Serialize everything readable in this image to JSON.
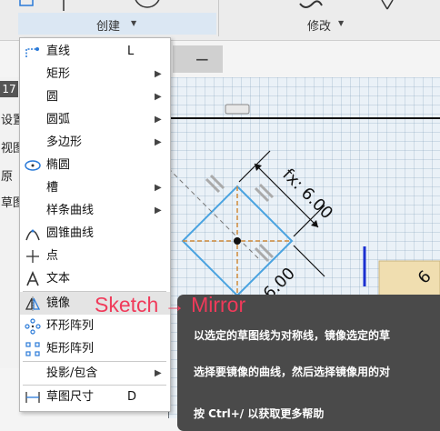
{
  "ribbon": {
    "create_label": "创建",
    "modify_label": "修改"
  },
  "left_panel": {
    "items": [
      "17",
      "设置",
      "视图",
      "原",
      "草图"
    ]
  },
  "menu": {
    "items": [
      {
        "label": "直线",
        "shortcut": "L",
        "icon": "line-icon",
        "submenu": false
      },
      {
        "label": "矩形",
        "shortcut": "",
        "icon": "",
        "submenu": true
      },
      {
        "label": "圆",
        "shortcut": "",
        "icon": "",
        "submenu": true
      },
      {
        "label": "圆弧",
        "shortcut": "",
        "icon": "",
        "submenu": true
      },
      {
        "label": "多边形",
        "shortcut": "",
        "icon": "",
        "submenu": true
      },
      {
        "label": "椭圆",
        "shortcut": "",
        "icon": "ellipse-icon",
        "submenu": false
      },
      {
        "label": "槽",
        "shortcut": "",
        "icon": "",
        "submenu": true
      },
      {
        "label": "样条曲线",
        "shortcut": "",
        "icon": "",
        "submenu": true
      },
      {
        "label": "圆锥曲线",
        "shortcut": "",
        "icon": "conic-curve-icon",
        "submenu": false
      },
      {
        "label": "点",
        "shortcut": "",
        "icon": "point-icon",
        "submenu": false
      },
      {
        "label": "文本",
        "shortcut": "",
        "icon": "text-icon",
        "submenu": false
      },
      {
        "label": "镜像",
        "shortcut": "",
        "icon": "mirror-icon",
        "submenu": false,
        "highlighted": true
      },
      {
        "label": "环形阵列",
        "shortcut": "",
        "icon": "circular-pattern-icon",
        "submenu": false
      },
      {
        "label": "矩形阵列",
        "shortcut": "",
        "icon": "rectangular-pattern-icon",
        "submenu": false
      },
      {
        "label": "投影/包含",
        "shortcut": "",
        "icon": "",
        "submenu": true
      },
      {
        "label": "草图尺寸",
        "shortcut": "D",
        "icon": "sketch-dimension-icon",
        "submenu": false
      }
    ]
  },
  "canvas": {
    "dim_top": "fx: 6.00",
    "dim_bottom": "6.00",
    "dim_right": "6"
  },
  "tooltip": {
    "title": "Sketch → Mirror",
    "line1": "以选定的草图线为对称线，镜像选定的草",
    "line2": "选择要镜像的曲线，然后选择镜像用的对",
    "line3": "按 Ctrl+/ 以获取更多帮助"
  },
  "colors": {
    "accent": "#2a7ad8",
    "tooltip_title": "#f03a5a",
    "tooltip_bg": "#4a4a4a",
    "canvas_bg": "#eaf1f7",
    "sketch_line": "#4aa3e0",
    "construction_line": "#d08a3a"
  }
}
